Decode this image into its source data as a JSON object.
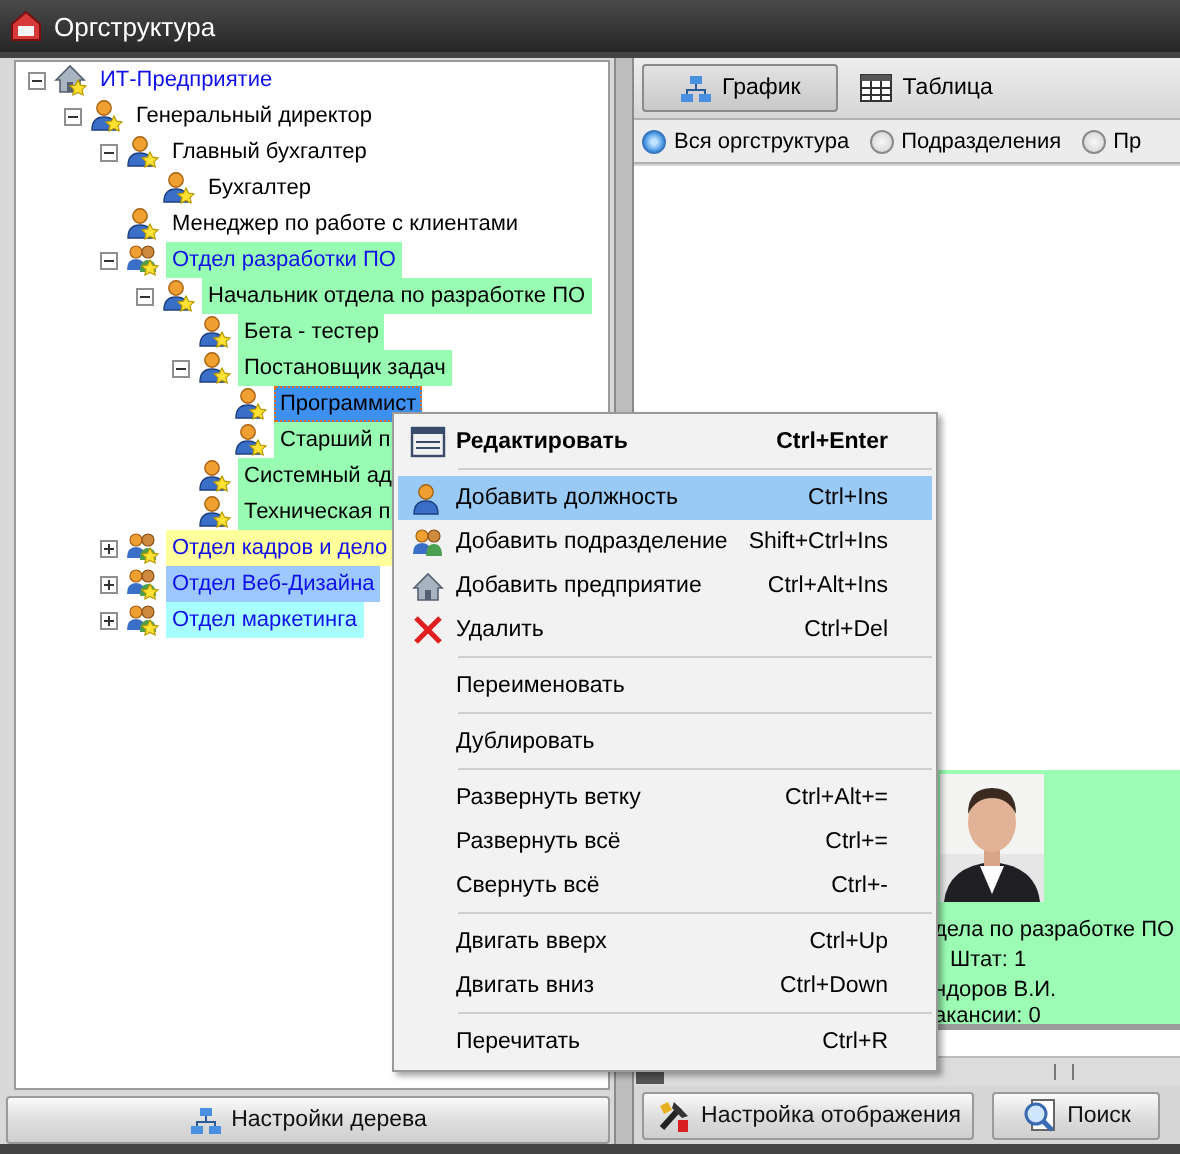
{
  "window": {
    "title": "Оргструктура"
  },
  "tree": {
    "nodes": [
      {
        "label": "ИТ-Предприятие",
        "kind": "enterprise",
        "expanded": true,
        "selected": false,
        "children": [
          {
            "label": "Генеральный директор",
            "kind": "position",
            "expanded": true,
            "selected": false,
            "children": [
              {
                "label": "Главный бухгалтер",
                "kind": "position",
                "expanded": true,
                "selected": false,
                "children": [
                  {
                    "label": "Бухгалтер",
                    "kind": "position",
                    "selected": false
                  }
                ]
              },
              {
                "label": "Менеджер по работе с клиентами",
                "kind": "position",
                "selected": false
              },
              {
                "label": "Отдел разработки ПО",
                "kind": "department",
                "expanded": true,
                "selected": false,
                "color": "#98fcb2",
                "children": [
                  {
                    "label": "Начальник отдела по разработке ПО",
                    "kind": "position",
                    "expanded": true,
                    "selected": false,
                    "color": "#98fcb2",
                    "children": [
                      {
                        "label": "Бета - тестер",
                        "kind": "position",
                        "selected": false,
                        "color": "#98fcb2"
                      },
                      {
                        "label": "Постановщик задач",
                        "kind": "position",
                        "expanded": true,
                        "selected": false,
                        "color": "#98fcb2",
                        "children": [
                          {
                            "label": "Программист",
                            "kind": "position",
                            "selected": true
                          },
                          {
                            "label": "Старший п",
                            "kind": "position",
                            "selected": false,
                            "color": "#98fcb2"
                          }
                        ]
                      },
                      {
                        "label": "Системный ад",
                        "kind": "position",
                        "selected": false,
                        "color": "#98fcb2"
                      },
                      {
                        "label": "Техническая п",
                        "kind": "position",
                        "selected": false,
                        "color": "#98fcb2"
                      }
                    ]
                  }
                ]
              },
              {
                "label": "Отдел кадров и дело",
                "kind": "department",
                "expanded": false,
                "selected": false,
                "color": "#ffff9c"
              },
              {
                "label": "Отдел Веб-Дизайна",
                "kind": "department",
                "expanded": false,
                "selected": false,
                "color": "#9cc8ff"
              },
              {
                "label": "Отдел маркетинга",
                "kind": "department",
                "expanded": false,
                "selected": false,
                "color": "#a8ffff"
              }
            ]
          }
        ]
      }
    ]
  },
  "tree_settings_button": "Настройки дерева",
  "view_tabs": [
    {
      "label": "График",
      "selected": true
    },
    {
      "label": "Таблица",
      "selected": false
    }
  ],
  "filter_radios": [
    {
      "label": "Вся оргструктура",
      "selected": true
    },
    {
      "label": "Подразделения",
      "selected": false
    },
    {
      "label": "Пр",
      "selected": false
    }
  ],
  "chart_card": {
    "lines": [
      "дела по разработке ПО",
      "Штат: 1",
      "ндоров В.И.",
      "акансии: 0"
    ]
  },
  "bottom_buttons": [
    "Настройка отображения",
    "Поиск"
  ],
  "context_menu": {
    "groups": [
      [
        {
          "label": "Редактировать",
          "shortcut": "Ctrl+Enter",
          "default": true,
          "selected": false
        }
      ],
      [
        {
          "label": "Добавить должность",
          "shortcut": "Ctrl+Ins",
          "default": false,
          "selected": true
        },
        {
          "label": "Добавить подразделение",
          "shortcut": "Shift+Ctrl+Ins",
          "default": false,
          "selected": false
        },
        {
          "label": "Добавить предприятие",
          "shortcut": "Ctrl+Alt+Ins",
          "default": false,
          "selected": false
        },
        {
          "label": "Удалить",
          "shortcut": "Ctrl+Del",
          "default": false,
          "selected": false
        }
      ],
      [
        {
          "label": "Переименовать",
          "default": false,
          "selected": false
        }
      ],
      [
        {
          "label": "Дублировать",
          "default": false,
          "selected": false
        }
      ],
      [
        {
          "label": "Развернуть ветку",
          "shortcut": "Ctrl+Alt+=",
          "default": false,
          "selected": false
        },
        {
          "label": "Развернуть всё",
          "shortcut": "Ctrl+=",
          "default": false,
          "selected": false
        },
        {
          "label": "Свернуть всё",
          "shortcut": "Ctrl+-",
          "default": false,
          "selected": false
        }
      ],
      [
        {
          "label": "Двигать вверх",
          "shortcut": "Ctrl+Up",
          "default": false,
          "selected": false
        },
        {
          "label": "Двигать вниз",
          "shortcut": "Ctrl+Down",
          "default": false,
          "selected": false
        }
      ],
      [
        {
          "label": "Перечитать",
          "shortcut": "Ctrl+R",
          "default": false,
          "selected": false
        }
      ]
    ]
  }
}
